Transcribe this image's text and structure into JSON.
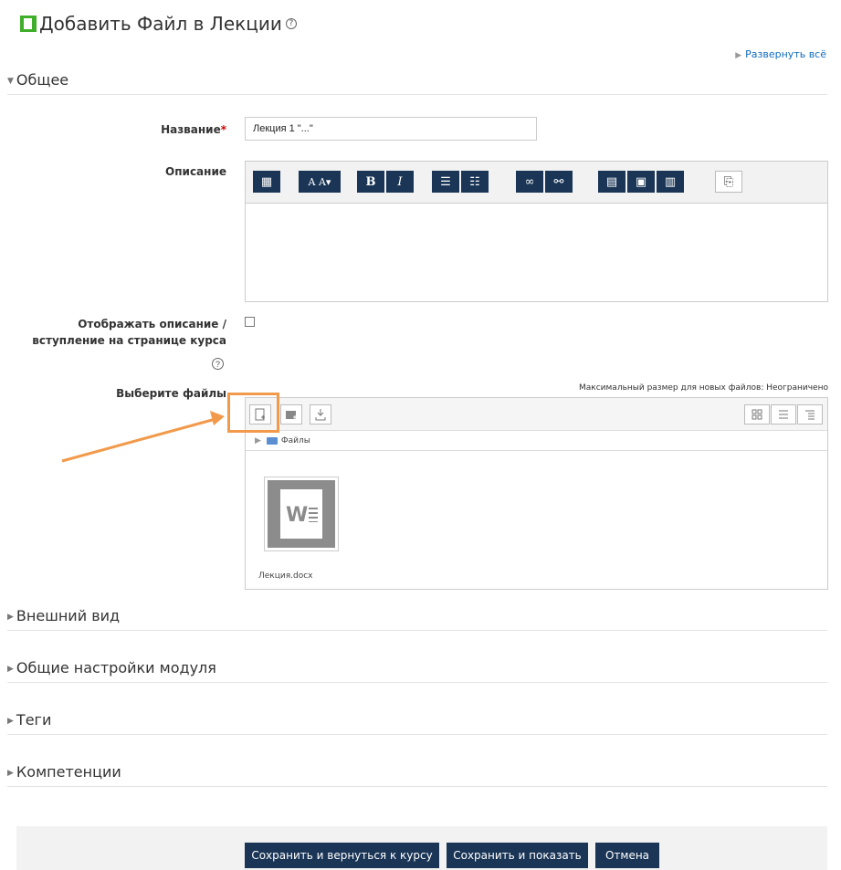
{
  "page": {
    "title": "Добавить Файл в Лекции",
    "help": "?",
    "expand_all": "Развернуть всё"
  },
  "sections": {
    "general": "Общее",
    "appearance": "Внешний вид",
    "module_settings": "Общие настройки модуля",
    "tags": "Теги",
    "competencies": "Компетенции"
  },
  "form": {
    "name_label": "Название",
    "required_mark": "*",
    "name_value": "Лекция 1 \"...\"",
    "description_label": "Описание",
    "show_description_label_1": "Отображать описание /",
    "show_description_label_2": "вступление на странице курса",
    "show_description_checked": false,
    "files_label": "Выберите файлы",
    "max_size": "Максимальный размер для новых файлов: Неограничено"
  },
  "editor": {
    "buttons": [
      {
        "icon": "toolbar-toggle-icon",
        "glyph": "▦"
      },
      {
        "icon": "font-style-icon",
        "glyph": "A̲A▾"
      },
      {
        "icon": "bold-icon",
        "glyph": "B"
      },
      {
        "icon": "italic-icon",
        "glyph": "I"
      },
      {
        "icon": "unordered-list-icon",
        "glyph": "☰"
      },
      {
        "icon": "ordered-list-icon",
        "glyph": "☷"
      },
      {
        "icon": "link-icon",
        "glyph": "🔗"
      },
      {
        "icon": "unlink-icon",
        "glyph": "⛓"
      },
      {
        "icon": "manage-files-icon",
        "glyph": "▤"
      },
      {
        "icon": "image-icon",
        "glyph": "▣"
      },
      {
        "icon": "media-icon",
        "glyph": "▥"
      },
      {
        "icon": "paste-icon",
        "glyph": "⎘"
      }
    ]
  },
  "filemanager": {
    "path": "Файлы",
    "file_name": "Лекция.docx",
    "file_icon": "word-file-icon"
  },
  "footer": {
    "save_return": "Сохранить и вернуться к курсу",
    "save_show": "Сохранить и показать",
    "cancel": "Отмена"
  },
  "colors": {
    "accent": "#1a3556",
    "highlight": "#f29a4b",
    "link": "#0f6cbf",
    "brand_green": "#3fae2a"
  }
}
